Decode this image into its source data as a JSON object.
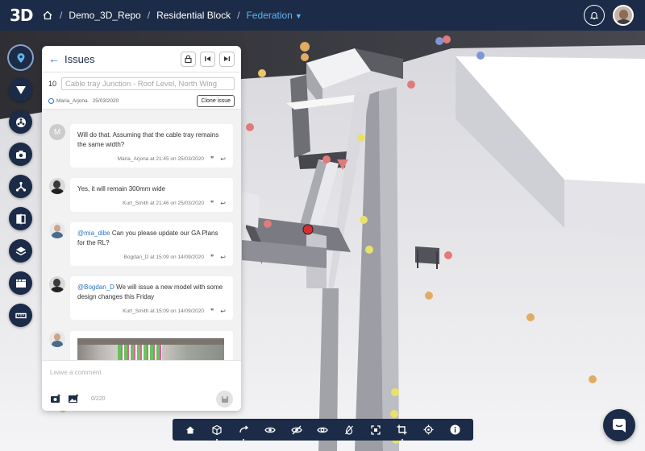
{
  "header": {
    "logo": "3D",
    "breadcrumbs": [
      "Demo_3D_Repo",
      "Residential Block",
      "Federation"
    ],
    "separator": "/"
  },
  "colors": {
    "nav": "#1c2b47",
    "accent": "#5fb4f0",
    "link": "#2b74c2",
    "pin_yellow": "#e9d36a",
    "pin_orange": "#e0ac63",
    "pin_red": "#e07b7b",
    "pin_blue": "#7e97d4"
  },
  "left_toolbar": [
    "issues-pin-icon",
    "risks-triangle-icon",
    "hazard-icon",
    "camera-icon",
    "tree-icon",
    "compare-icon",
    "layers-icon",
    "sequences-clapper-icon",
    "measure-ruler-icon"
  ],
  "issues_panel": {
    "title": "Issues",
    "issue_number": "10",
    "issue_title": "Cable tray Junction - Roof Level, North Wing",
    "owner": "Maria_Arjona",
    "date": "25/03/2020",
    "clone_label": "Clone issue",
    "comments": [
      {
        "avatar_letter": "M",
        "text": "Will do that. Assuming that the cable tray remains the same width?",
        "meta": "Maria_Arjona at 21:45 on 25/03/2020"
      },
      {
        "text": "Yes, it will remain 300mm wide",
        "meta": "Kurt_Smith at 21:46 on 25/03/2020"
      },
      {
        "mention": "@mia_dibe",
        "text": " Can you please update our GA Plans for the RL?",
        "meta": "Bogdan_D at 15:09 on 14/09/2020"
      },
      {
        "mention": "@Bogdan_D",
        "text": " We will issue a new model with some design changes this Friday",
        "meta": "Kurt_Smith at 15:09 on 14/09/2020"
      }
    ],
    "comment_placeholder": "Leave a comment",
    "char_count": "0/220",
    "quote_glyph": "❞",
    "reply_glyph": "↩"
  },
  "bottom_toolbar": [
    "home-icon",
    "view-cube-icon",
    "redo-icon",
    "show-icon",
    "hide-icon",
    "isolate-icon",
    "hide-ifc-icon",
    "focus-icon",
    "clip-icon",
    "coordinates-icon",
    "info-icon"
  ]
}
